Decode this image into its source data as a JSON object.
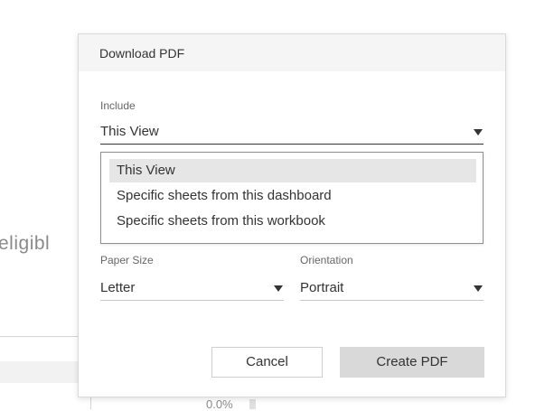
{
  "background": {
    "partial_word": "eligibl",
    "percent_text": "0.0%"
  },
  "dialog": {
    "title": "Download PDF",
    "include": {
      "label": "Include",
      "value": "This View",
      "options": [
        "This View",
        "Specific sheets from this dashboard",
        "Specific sheets from this workbook"
      ],
      "selected_index": 0
    },
    "paper_size": {
      "label": "Paper Size",
      "value": "Letter"
    },
    "orientation": {
      "label": "Orientation",
      "value": "Portrait"
    },
    "buttons": {
      "cancel": "Cancel",
      "create": "Create PDF"
    }
  }
}
